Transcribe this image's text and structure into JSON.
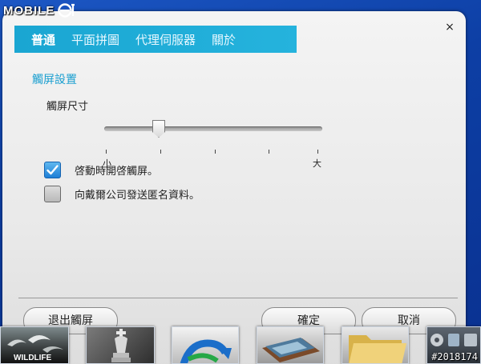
{
  "watermark": {
    "logo_text": "MOBILE",
    "image_id": "#2018174"
  },
  "dialog": {
    "close_label": "×",
    "tabs": [
      {
        "label": "普通",
        "active": true
      },
      {
        "label": "平面拼圖",
        "active": false
      },
      {
        "label": "代理伺服器",
        "active": false
      },
      {
        "label": "關於",
        "active": false
      }
    ],
    "section_title": "觸屏設置",
    "size": {
      "label": "觸屏尺寸",
      "min_label": "小",
      "max_label": "大",
      "value_fraction": 0.25
    },
    "options": [
      {
        "label": "啓動時開啓觸屏。",
        "checked": true
      },
      {
        "label": "向戴爾公司發送匿名資料。",
        "checked": false
      }
    ],
    "buttons": {
      "exit": "退出觸屏",
      "ok": "確定",
      "cancel": "取消"
    }
  },
  "dock": {
    "items": [
      "wildlife-video",
      "chess-game",
      "refresh-app",
      "photo-album",
      "folder",
      "media-tools"
    ],
    "wildlife_label": "WILDLIFE"
  },
  "colors": {
    "accent": "#1a9fd0",
    "tab_bar": "#1fa9d6",
    "check_blue": "#1e7fd6",
    "desktop": "#0d3fa5"
  }
}
